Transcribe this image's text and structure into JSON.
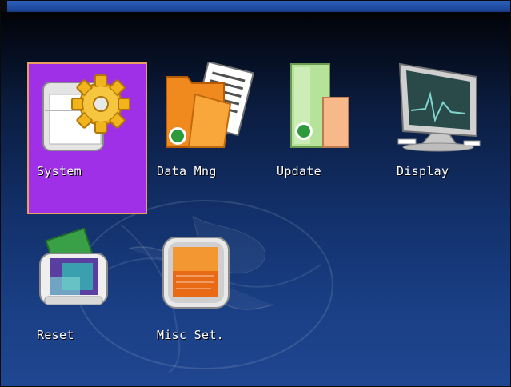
{
  "menu": {
    "selected": "System",
    "items": [
      {
        "label": "System",
        "icon": "system-gear-folder-icon"
      },
      {
        "label": "Data Mng",
        "icon": "data-folder-icon"
      },
      {
        "label": "Update",
        "icon": "update-icon"
      },
      {
        "label": "Display",
        "icon": "monitor-icon"
      },
      {
        "label": "Reset",
        "icon": "reset-icon"
      },
      {
        "label": "Misc Set.",
        "icon": "misc-settings-icon"
      }
    ]
  },
  "colors": {
    "selection_fill": "#a030e8",
    "selection_border": "#e8a060",
    "background_top": "#000000",
    "background_bottom": "#1f4690",
    "top_bar": "#2d5fb8"
  }
}
